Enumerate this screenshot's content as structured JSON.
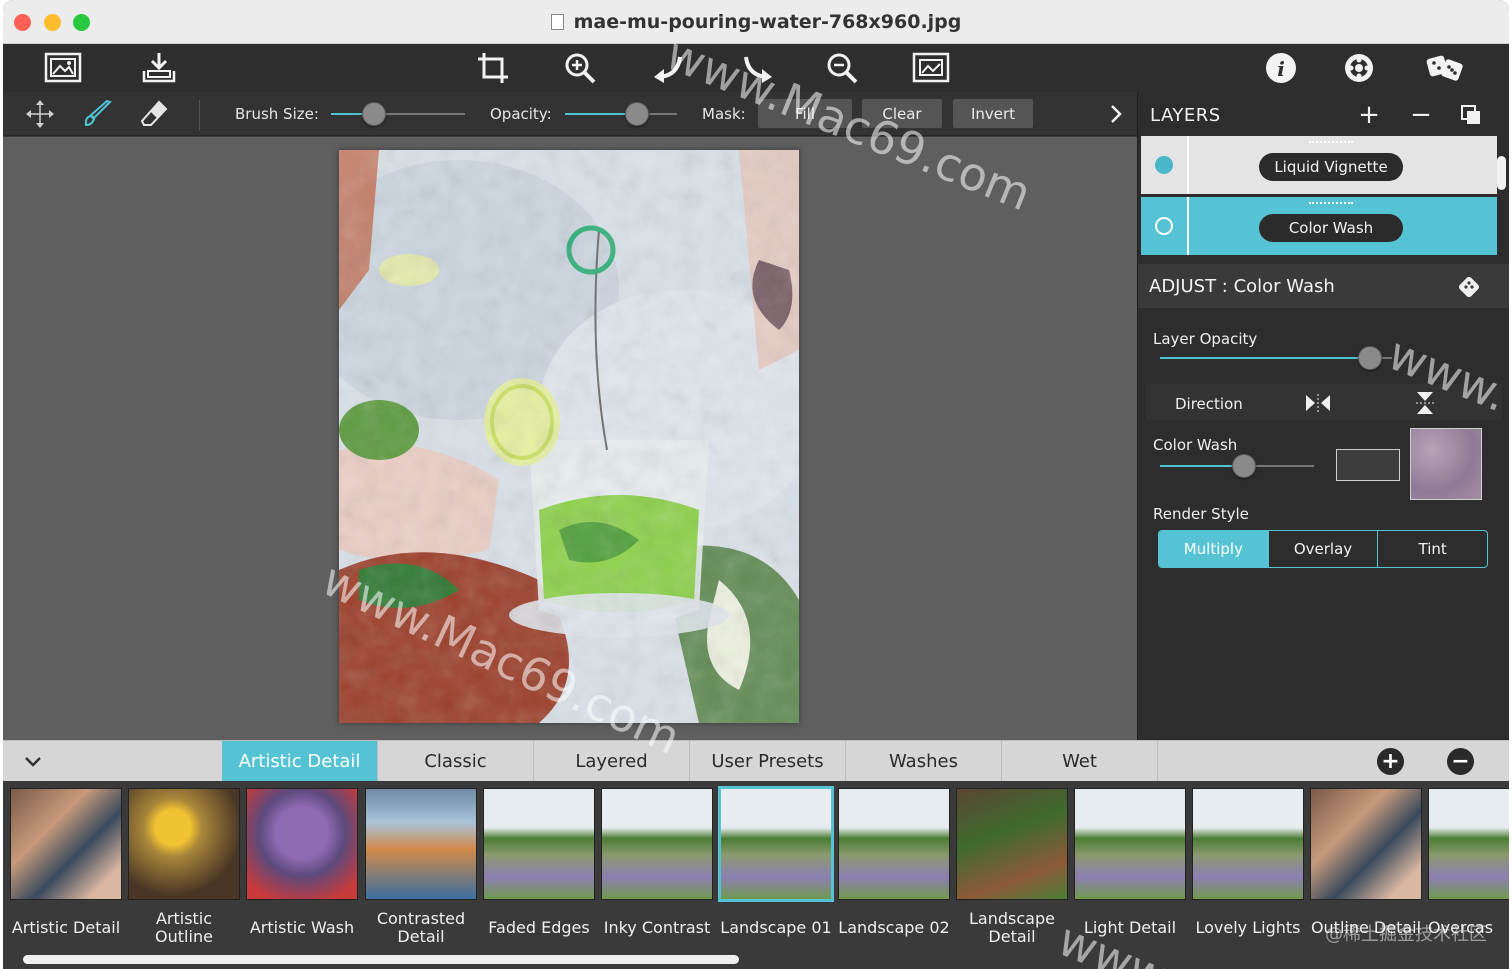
{
  "window": {
    "title": "mae-mu-pouring-water-768x960.jpg"
  },
  "toolbar": {
    "left_icons": [
      "open-image-icon",
      "save-download-icon"
    ],
    "center_icons": [
      "crop-icon",
      "zoom-in-icon",
      "undo-icon",
      "redo-icon",
      "zoom-out-icon",
      "fit-image-icon"
    ],
    "right_icons": [
      "info-icon",
      "settings-gear-icon",
      "random-dice-icon"
    ]
  },
  "brushbar": {
    "brush_size_label": "Brush Size:",
    "brush_size_value": 0.28,
    "opacity_label": "Opacity:",
    "opacity_value": 0.68,
    "mask_label": "Mask:",
    "fill_label": "Fill",
    "clear_label": "Clear",
    "invert_label": "Invert"
  },
  "layers": {
    "title": "LAYERS",
    "items": [
      {
        "label": "Liquid Vignette",
        "active": false
      },
      {
        "label": "Color Wash",
        "active": true
      }
    ]
  },
  "adjust": {
    "title": "ADJUST : Color Wash",
    "layer_opacity_label": "Layer Opacity",
    "layer_opacity_value": 0.95,
    "direction_label": "Direction",
    "color_wash_label": "Color Wash",
    "color_wash_value": 0.55,
    "render_style_label": "Render Style",
    "render_styles": [
      "Multiply",
      "Overlay",
      "Tint"
    ],
    "render_style_selected": "Multiply"
  },
  "preset_tabs": {
    "tabs": [
      "Artistic Detail",
      "Classic",
      "Layered",
      "User Presets",
      "Washes",
      "Wet"
    ],
    "selected": "Artistic Detail"
  },
  "presets": [
    {
      "label": "Artistic Detail"
    },
    {
      "label": "Artistic Outline"
    },
    {
      "label": "Artistic Wash"
    },
    {
      "label": "Contrasted Detail"
    },
    {
      "label": "Faded Edges"
    },
    {
      "label": "Inky Contrast"
    },
    {
      "label": "Landscape 01"
    },
    {
      "label": "Landscape 02"
    },
    {
      "label": "Landscape Detail"
    },
    {
      "label": "Light Detail"
    },
    {
      "label": "Lovely Lights"
    },
    {
      "label": "Outline Detail"
    },
    {
      "label": "Overcas"
    }
  ],
  "watermarks": {
    "top": "www.Mac69.com",
    "canvas": "www.Mac69.com",
    "right": "www.",
    "bottom": "www.",
    "cn": "@稀土掘金技术社区"
  },
  "colors": {
    "accent": "#55c3d3",
    "panel": "#2d2d2d",
    "canvas": "#5f5f5f"
  }
}
